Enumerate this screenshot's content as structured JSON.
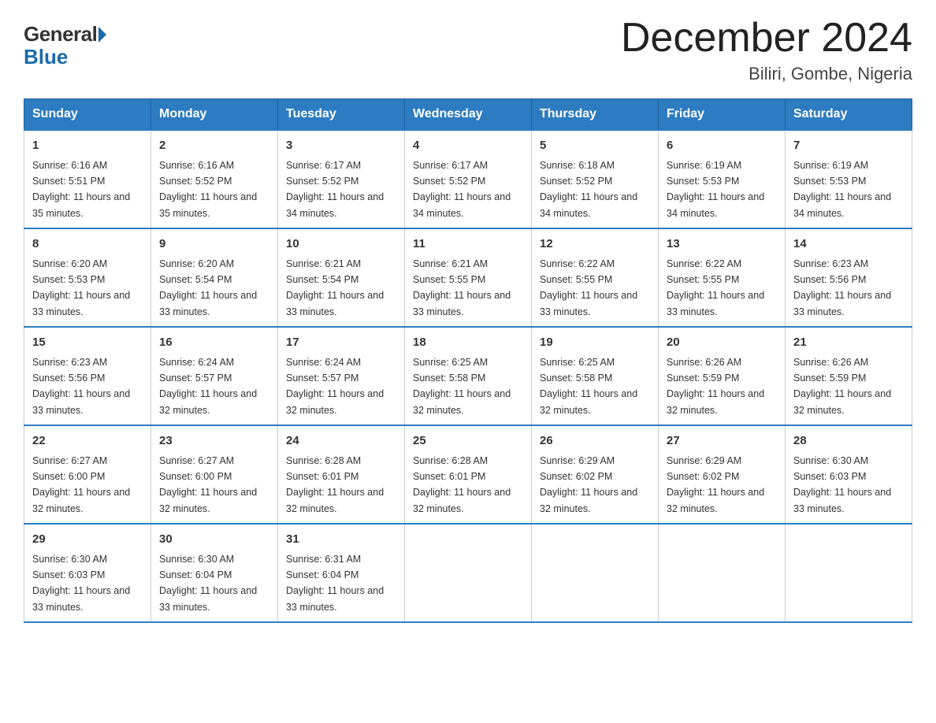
{
  "header": {
    "logo_general": "General",
    "logo_blue": "Blue",
    "month_title": "December 2024",
    "location": "Biliri, Gombe, Nigeria"
  },
  "days_of_week": [
    "Sunday",
    "Monday",
    "Tuesday",
    "Wednesday",
    "Thursday",
    "Friday",
    "Saturday"
  ],
  "weeks": [
    [
      {
        "day": "1",
        "sunrise": "6:16 AM",
        "sunset": "5:51 PM",
        "daylight": "11 hours and 35 minutes."
      },
      {
        "day": "2",
        "sunrise": "6:16 AM",
        "sunset": "5:52 PM",
        "daylight": "11 hours and 35 minutes."
      },
      {
        "day": "3",
        "sunrise": "6:17 AM",
        "sunset": "5:52 PM",
        "daylight": "11 hours and 34 minutes."
      },
      {
        "day": "4",
        "sunrise": "6:17 AM",
        "sunset": "5:52 PM",
        "daylight": "11 hours and 34 minutes."
      },
      {
        "day": "5",
        "sunrise": "6:18 AM",
        "sunset": "5:52 PM",
        "daylight": "11 hours and 34 minutes."
      },
      {
        "day": "6",
        "sunrise": "6:19 AM",
        "sunset": "5:53 PM",
        "daylight": "11 hours and 34 minutes."
      },
      {
        "day": "7",
        "sunrise": "6:19 AM",
        "sunset": "5:53 PM",
        "daylight": "11 hours and 34 minutes."
      }
    ],
    [
      {
        "day": "8",
        "sunrise": "6:20 AM",
        "sunset": "5:53 PM",
        "daylight": "11 hours and 33 minutes."
      },
      {
        "day": "9",
        "sunrise": "6:20 AM",
        "sunset": "5:54 PM",
        "daylight": "11 hours and 33 minutes."
      },
      {
        "day": "10",
        "sunrise": "6:21 AM",
        "sunset": "5:54 PM",
        "daylight": "11 hours and 33 minutes."
      },
      {
        "day": "11",
        "sunrise": "6:21 AM",
        "sunset": "5:55 PM",
        "daylight": "11 hours and 33 minutes."
      },
      {
        "day": "12",
        "sunrise": "6:22 AM",
        "sunset": "5:55 PM",
        "daylight": "11 hours and 33 minutes."
      },
      {
        "day": "13",
        "sunrise": "6:22 AM",
        "sunset": "5:55 PM",
        "daylight": "11 hours and 33 minutes."
      },
      {
        "day": "14",
        "sunrise": "6:23 AM",
        "sunset": "5:56 PM",
        "daylight": "11 hours and 33 minutes."
      }
    ],
    [
      {
        "day": "15",
        "sunrise": "6:23 AM",
        "sunset": "5:56 PM",
        "daylight": "11 hours and 33 minutes."
      },
      {
        "day": "16",
        "sunrise": "6:24 AM",
        "sunset": "5:57 PM",
        "daylight": "11 hours and 32 minutes."
      },
      {
        "day": "17",
        "sunrise": "6:24 AM",
        "sunset": "5:57 PM",
        "daylight": "11 hours and 32 minutes."
      },
      {
        "day": "18",
        "sunrise": "6:25 AM",
        "sunset": "5:58 PM",
        "daylight": "11 hours and 32 minutes."
      },
      {
        "day": "19",
        "sunrise": "6:25 AM",
        "sunset": "5:58 PM",
        "daylight": "11 hours and 32 minutes."
      },
      {
        "day": "20",
        "sunrise": "6:26 AM",
        "sunset": "5:59 PM",
        "daylight": "11 hours and 32 minutes."
      },
      {
        "day": "21",
        "sunrise": "6:26 AM",
        "sunset": "5:59 PM",
        "daylight": "11 hours and 32 minutes."
      }
    ],
    [
      {
        "day": "22",
        "sunrise": "6:27 AM",
        "sunset": "6:00 PM",
        "daylight": "11 hours and 32 minutes."
      },
      {
        "day": "23",
        "sunrise": "6:27 AM",
        "sunset": "6:00 PM",
        "daylight": "11 hours and 32 minutes."
      },
      {
        "day": "24",
        "sunrise": "6:28 AM",
        "sunset": "6:01 PM",
        "daylight": "11 hours and 32 minutes."
      },
      {
        "day": "25",
        "sunrise": "6:28 AM",
        "sunset": "6:01 PM",
        "daylight": "11 hours and 32 minutes."
      },
      {
        "day": "26",
        "sunrise": "6:29 AM",
        "sunset": "6:02 PM",
        "daylight": "11 hours and 32 minutes."
      },
      {
        "day": "27",
        "sunrise": "6:29 AM",
        "sunset": "6:02 PM",
        "daylight": "11 hours and 32 minutes."
      },
      {
        "day": "28",
        "sunrise": "6:30 AM",
        "sunset": "6:03 PM",
        "daylight": "11 hours and 33 minutes."
      }
    ],
    [
      {
        "day": "29",
        "sunrise": "6:30 AM",
        "sunset": "6:03 PM",
        "daylight": "11 hours and 33 minutes."
      },
      {
        "day": "30",
        "sunrise": "6:30 AM",
        "sunset": "6:04 PM",
        "daylight": "11 hours and 33 minutes."
      },
      {
        "day": "31",
        "sunrise": "6:31 AM",
        "sunset": "6:04 PM",
        "daylight": "11 hours and 33 minutes."
      },
      null,
      null,
      null,
      null
    ]
  ]
}
